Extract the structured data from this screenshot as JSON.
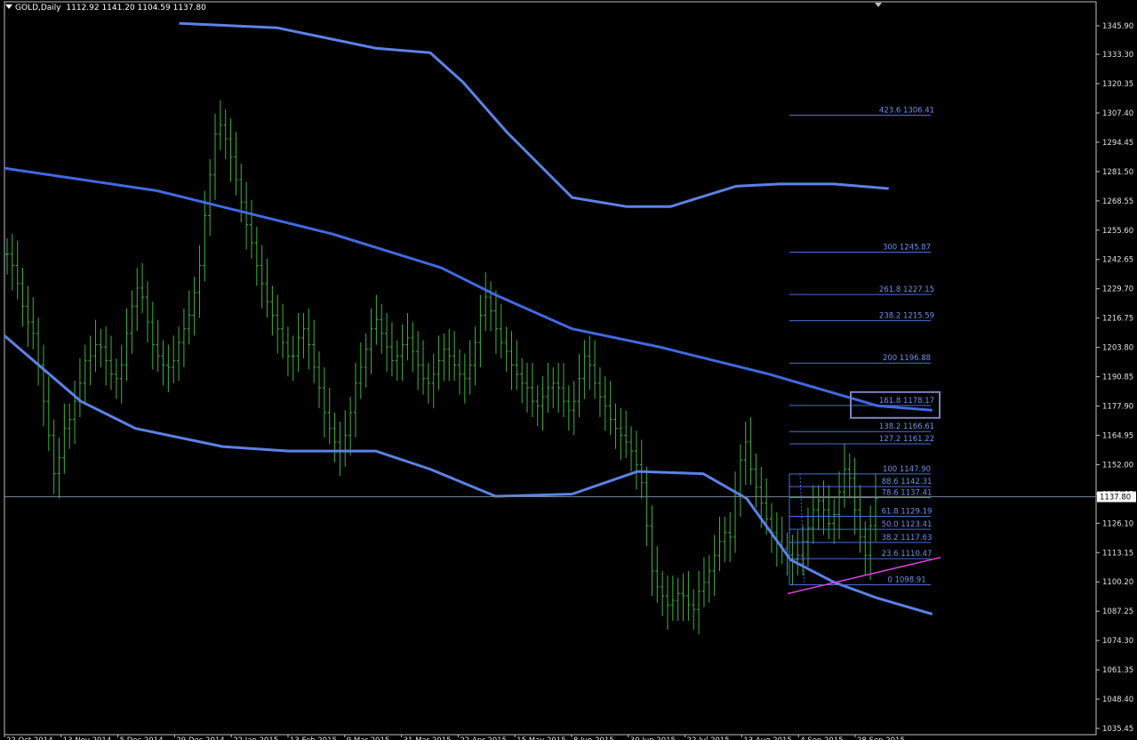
{
  "header": {
    "symbol": "GOLD,Daily",
    "ohlc": "1112.92 1141.20 1104.59 1137.80"
  },
  "chart_data": {
    "type": "line",
    "title": "GOLD,Daily",
    "y_ticks": [
      "1345.90",
      "1333.30",
      "1320.35",
      "1307.40",
      "1294.45",
      "1281.50",
      "1268.55",
      "1255.60",
      "1242.65",
      "1229.70",
      "1216.75",
      "1203.80",
      "1190.85",
      "1177.90",
      "1164.95",
      "1152.00",
      "1139.05",
      "1126.10",
      "1113.15",
      "1100.20",
      "1087.25",
      "1074.30",
      "1061.35",
      "1048.40",
      "1035.45"
    ],
    "ylim": [
      1035.45,
      1345.9
    ],
    "x_ticks": [
      "22 Oct 2014",
      "13 Nov 2014",
      "5 Dec 2014",
      "29 Dec 2014",
      "22 Jan 2015",
      "13 Feb 2015",
      "9 Mar 2015",
      "31 Mar 2015",
      "22 Apr 2015",
      "15 May 2015",
      "8 Jun 2015",
      "30 Jun 2015",
      "22 Jul 2015",
      "13 Aug 2015",
      "4 Sep 2015",
      "28 Sep 2015"
    ],
    "current_price": "1137.80",
    "price_bars_sampled": [
      1245,
      1240,
      1232,
      1222,
      1215,
      1210,
      1196,
      1180,
      1165,
      1148,
      1155,
      1168,
      1172,
      1180,
      1188,
      1198,
      1200,
      1205,
      1204,
      1198,
      1192,
      1190,
      1196,
      1210,
      1222,
      1230,
      1226,
      1215,
      1205,
      1200,
      1196,
      1195,
      1198,
      1206,
      1212,
      1218,
      1228,
      1240,
      1262,
      1280,
      1298,
      1302,
      1296,
      1288,
      1278,
      1268,
      1258,
      1250,
      1240,
      1232,
      1224,
      1218,
      1212,
      1206,
      1200,
      1200,
      1208,
      1212,
      1205,
      1195,
      1186,
      1175,
      1168,
      1162,
      1158,
      1165,
      1175,
      1188,
      1195,
      1203,
      1212,
      1216,
      1210,
      1204,
      1198,
      1200,
      1205,
      1208,
      1202,
      1196,
      1190,
      1188,
      1192,
      1198,
      1203,
      1200,
      1196,
      1192,
      1190,
      1196,
      1206,
      1218,
      1226,
      1220,
      1212,
      1206,
      1202,
      1196,
      1192,
      1188,
      1186,
      1180,
      1178,
      1182,
      1186,
      1188,
      1186,
      1180,
      1176,
      1180,
      1190,
      1200,
      1196,
      1188,
      1182,
      1178,
      1172,
      1168,
      1165,
      1162,
      1158,
      1152,
      1144,
      1125,
      1105,
      1098,
      1094,
      1090,
      1092,
      1095,
      1094,
      1090,
      1088,
      1096,
      1100,
      1105,
      1112,
      1118,
      1122,
      1120,
      1138,
      1154,
      1162,
      1150,
      1142,
      1135,
      1128,
      1122,
      1118,
      1115,
      1112,
      1110,
      1112,
      1118,
      1124,
      1132,
      1136,
      1132,
      1126,
      1130,
      1140,
      1150,
      1146,
      1132,
      1120,
      1112,
      1125,
      1137
    ],
    "series": [
      {
        "name": "",
        "color": "#4169e1",
        "x": [
          0,
          0.14,
          0.3,
          0.4,
          0.45,
          0.52,
          0.6,
          0.7,
          0.8,
          0.85
        ],
        "values": [
          1283,
          1273,
          1254,
          1239,
          1227,
          1212,
          1204,
          1192,
          1178,
          1176
        ]
      },
      {
        "name": "",
        "color": "#5b82e6",
        "x": [
          0,
          0.07,
          0.12,
          0.2,
          0.26,
          0.34,
          0.39,
          0.45,
          0.52,
          0.58,
          0.64,
          0.68,
          0.72,
          0.76,
          0.8,
          0.85
        ],
        "values": [
          1209,
          1180,
          1168,
          1160,
          1158,
          1158,
          1150,
          1138,
          1139,
          1149,
          1148,
          1137,
          1110,
          1100,
          1093,
          1086
        ]
      },
      {
        "name": "",
        "color": "#5b82e6",
        "x": [
          0.16,
          0.25,
          0.3,
          0.34,
          0.39,
          0.42,
          0.46,
          0.52,
          0.57,
          0.61,
          0.67,
          0.71,
          0.76,
          0.81
        ],
        "values": [
          1347,
          1345,
          1340,
          1336,
          1334,
          1321,
          1299,
          1270,
          1266,
          1266,
          1275,
          1276,
          1276,
          1274
        ]
      }
    ],
    "fibonacci_levels": [
      {
        "label": "423.6 1306.41",
        "value": 1306.41
      },
      {
        "label": "300 1245.87",
        "value": 1245.87
      },
      {
        "label": "261.8 1227.15",
        "value": 1227.15
      },
      {
        "label": "238.2 1215.59",
        "value": 1215.59
      },
      {
        "label": "200 1196.88",
        "value": 1196.88
      },
      {
        "label": "161.8 1178.17",
        "value": 1178.17
      },
      {
        "label": "138.2 1166.61",
        "value": 1166.61
      },
      {
        "label": "127.2 1161.22",
        "value": 1161.22
      },
      {
        "label": "100 1147.90",
        "value": 1147.9
      },
      {
        "label": "88.6 1142.31",
        "value": 1142.31
      },
      {
        "label": "78.6 1137.41",
        "value": 1137.41
      },
      {
        "label": "61.8 1129.19",
        "value": 1129.19
      },
      {
        "label": "50.0 1123.41",
        "value": 1123.41
      },
      {
        "label": "38.2 1117.63",
        "value": 1117.63
      },
      {
        "label": "23.6 1110.47",
        "value": 1110.47
      },
      {
        "label": "0 1098.91",
        "value": 1098.91
      }
    ],
    "highlighted_level": "161.8 1178.17",
    "trendline": {
      "color": "#e040e0",
      "from": 1095,
      "to": 1111
    },
    "bar_color": "#3cb33c",
    "grid": false
  }
}
